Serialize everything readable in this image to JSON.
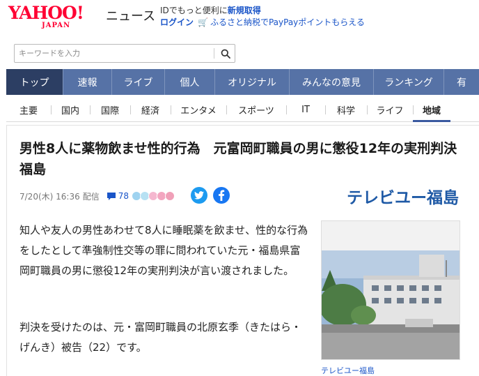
{
  "header": {
    "logo_text": "YAHOO!",
    "logo_sub": "JAPAN",
    "service_name": "ニュース",
    "promo_text": "IDでもっと便利に",
    "promo_link": "新規取得",
    "login_label": "ログイン",
    "furusato_text": "ふるさと納税でPayPayポイントもらえる"
  },
  "search": {
    "placeholder": "キーワードを入力"
  },
  "nav": {
    "items": [
      "トップ",
      "速報",
      "ライブ",
      "個人",
      "オリジナル",
      "みんなの意見",
      "ランキング",
      "有"
    ]
  },
  "subnav": {
    "items": [
      "主要",
      "国内",
      "国際",
      "経済",
      "エンタメ",
      "スポーツ",
      "IT",
      "科学",
      "ライフ",
      "地域"
    ]
  },
  "article": {
    "title": "男性8人に薬物飲ませ性的行為　元富岡町職員の男に懲役12年の実刑判決　福島",
    "date": "7/20(木) 16:36",
    "delivery": "配信",
    "comment_count": "78",
    "provider": "テレビユー福島",
    "paragraph1": "知人や友人の男性あわせて8人に睡眠薬を飲ませ、性的な行為をしたとして準強制性交等の罪に問われていた元・福島県富岡町職員の男に懲役12年の実刑判決が言い渡されました。",
    "paragraph2": "判決を受けたのは、元・富岡町職員の北原玄季（きたはら・げんき）被告（22）です。",
    "photo_caption": "テレビユー福島"
  },
  "colors": {
    "brand_red": "#ff0033",
    "nav_bg": "#5672a6",
    "nav_active": "#2c3e63",
    "link_blue": "#1a55c8",
    "twitter": "#1d9bf0",
    "facebook": "#1877f2"
  },
  "icons": [
    "search-icon",
    "cart-icon",
    "comment-icon",
    "twitter-icon",
    "facebook-icon"
  ]
}
